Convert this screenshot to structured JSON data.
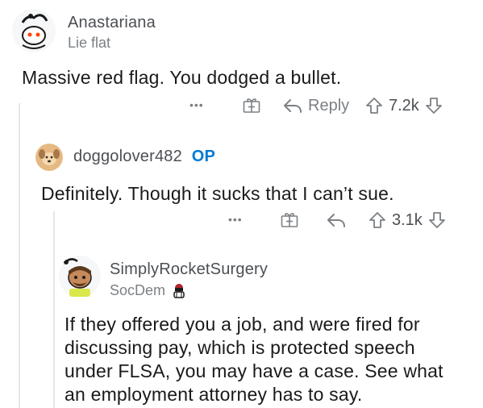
{
  "comments": [
    {
      "username": "Anastariana",
      "flair": "Lie flat",
      "text": "Massive red flag. You dodged a bullet.",
      "actions": {
        "more": "•••",
        "reply": "Reply",
        "votes": "7.2k"
      },
      "icons": [
        "more-icon",
        "gift-icon",
        "reply-arrow-icon",
        "upvote-icon",
        "downvote-icon"
      ]
    },
    {
      "username": "doggolover482",
      "op_badge": "OP",
      "text": "Definitely. Though it sucks that I can’t sue.",
      "actions": {
        "more": "•••",
        "votes": "3.1k"
      },
      "icons": [
        "more-icon",
        "gift-icon",
        "reply-arrow-icon",
        "upvote-icon",
        "downvote-icon"
      ]
    },
    {
      "username": "SimplyRocketSurgery",
      "flair": "SocDem",
      "text_lines": [
        "If they offered you a job, and were fired for",
        "discussing pay, which is protected speech",
        "under FLSA, you may have a case. See what",
        "an employment attorney has to say."
      ]
    }
  ],
  "colors": {
    "text": "#1a1a1b",
    "meta": "#7c8085",
    "username": "#4b4f54",
    "op": "#0079d3",
    "thread_line": "#e4e6e8"
  }
}
